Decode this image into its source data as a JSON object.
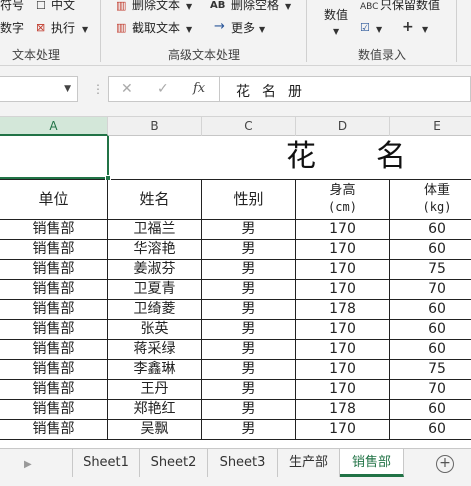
{
  "ribbon": {
    "text_group": {
      "items": [
        {
          "icon": "symbol-icon",
          "label": "符号"
        },
        {
          "icon": "checkbox-icon",
          "label": "中文"
        },
        {
          "icon": "text-icon",
          "label": "数字"
        },
        {
          "icon": "execute-icon",
          "label": "执行"
        }
      ],
      "group_label": "文本处理"
    },
    "advanced_group": {
      "items": [
        {
          "icon": "delete-text-icon",
          "label": "删除文本"
        },
        {
          "icon": "delete-spaces-icon",
          "label": "删除空格"
        },
        {
          "icon": "extract-text-icon",
          "label": "截取文本"
        },
        {
          "icon": "more-icon",
          "label": "更多"
        }
      ],
      "group_label": "高级文本处理"
    },
    "numeric_group": {
      "items": [
        {
          "icon": "numeric-icon",
          "label": "数值"
        },
        {
          "icon": "keep-numbers-icon",
          "label": "只保留数值"
        }
      ],
      "group_label": "数值录入"
    }
  },
  "formula_bar": {
    "name_box": "",
    "cancel": "✕",
    "confirm": "✓",
    "fx": "fx",
    "content": "花名册"
  },
  "columns": [
    "A",
    "B",
    "C",
    "D",
    "E"
  ],
  "sheet": {
    "title": "花名",
    "headers": {
      "dept": "单位",
      "name": "姓名",
      "gender": "性别",
      "height": "身高",
      "height_unit": "(cm)",
      "weight": "体重",
      "weight_unit": "(kg)"
    },
    "rows": [
      {
        "dept": "销售部",
        "name": "卫福兰",
        "gender": "男",
        "height": "170",
        "weight": "60"
      },
      {
        "dept": "销售部",
        "name": "华溶艳",
        "gender": "男",
        "height": "170",
        "weight": "60"
      },
      {
        "dept": "销售部",
        "name": "姜淑芬",
        "gender": "男",
        "height": "170",
        "weight": "75"
      },
      {
        "dept": "销售部",
        "name": "卫夏青",
        "gender": "男",
        "height": "170",
        "weight": "70"
      },
      {
        "dept": "销售部",
        "name": "卫绮菱",
        "gender": "男",
        "height": "178",
        "weight": "60"
      },
      {
        "dept": "销售部",
        "name": "张英",
        "gender": "男",
        "height": "170",
        "weight": "60"
      },
      {
        "dept": "销售部",
        "name": "蒋采绿",
        "gender": "男",
        "height": "170",
        "weight": "60"
      },
      {
        "dept": "销售部",
        "name": "李鑫琳",
        "gender": "男",
        "height": "170",
        "weight": "75"
      },
      {
        "dept": "销售部",
        "name": "王丹",
        "gender": "男",
        "height": "170",
        "weight": "70"
      },
      {
        "dept": "销售部",
        "name": "郑艳红",
        "gender": "男",
        "height": "178",
        "weight": "60"
      },
      {
        "dept": "销售部",
        "name": "吴飘",
        "gender": "男",
        "height": "170",
        "weight": "60"
      }
    ]
  },
  "tabs": {
    "items": [
      "Sheet1",
      "Sheet2",
      "Sheet3",
      "生产部",
      "销售部"
    ],
    "active": "销售部",
    "add": "+"
  },
  "colors": {
    "accent": "#217346"
  }
}
